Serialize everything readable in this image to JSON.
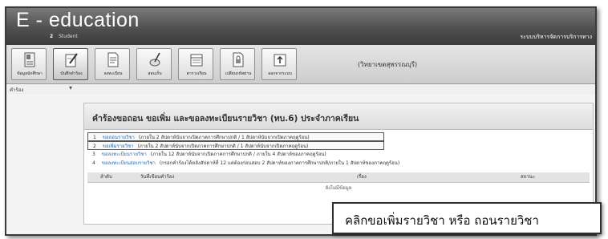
{
  "header": {
    "brand": "E - education",
    "user_id": "2",
    "user_role": "Student",
    "system_title": "ระบบบริหารจัดการบริการทาง"
  },
  "toolbar": {
    "buttons": [
      {
        "label": "ข้อมูลนักศึกษา",
        "icon": "student-info-icon"
      },
      {
        "label": "บันทึกคำร้อง",
        "icon": "edit-request-icon"
      },
      {
        "label": "ลงทะเบียน",
        "icon": "register-icon"
      },
      {
        "label": "สอบเก็บ",
        "icon": "exam-icon"
      },
      {
        "label": "ตารางเรียน",
        "icon": "schedule-icon"
      },
      {
        "label": "เปลี่ยนรหัสผ่าน",
        "icon": "password-icon"
      },
      {
        "label": "ออกจากระบบ",
        "icon": "logout-icon"
      }
    ],
    "note": "(วิทยาเขตสุพรรณบุรี)"
  },
  "menu": {
    "label": "คำร้อง",
    "arrow": "▾"
  },
  "panel": {
    "title": "คำร้องขอถอน ขอเพิ่ม และขอลงทะเบียนรายวิชา (ทบ.6) ประจำภาคเรียน",
    "requests": [
      {
        "num": "1",
        "name": "ขอถอนรายวิชา",
        "desc": "(ภายใน 2 สัปดาห์นับจากเปิดภาคการศึกษาปกติ / 1 สัปดาห์นับจากเปิดภาคฤดูร้อน)"
      },
      {
        "num": "2",
        "name": "ขอเพิ่มรายวิชา",
        "desc": "(ภายใน 2 สัปดาห์นับจากเปิดภาคการศึกษาปกติ / 1 สัปดาห์นับจากเปิดภาคฤดูร้อน)"
      },
      {
        "num": "3",
        "name": "ขอลงทะเบียนรายวิชา",
        "desc": "(ภายใน 12 สัปดาห์นับจากเปิดภาคการศึกษาปกติ / ภายใน 4 สัปดาห์ของภาคฤดูร้อน)"
      },
      {
        "num": "4",
        "name": "ขอลงทะเบียนสอบรายวิชา",
        "desc": "(กรอกคำร้องได้หลังสัปดาห์ที่ 12 แต่ต้องก่อนสอบ 2 สัปดาห์ของภาคการศึกษาปกติ/ภายใน 1 สัปดาห์ของภาคฤดูร้อน)"
      }
    ],
    "table_headers": [
      "ลำดับ",
      "วันที่เขียนคำร้อง",
      "เรื่อง",
      "สถานะ"
    ],
    "no_data": "ยังไม่มีข้อมูล"
  },
  "callout": {
    "text": "คลิกขอเพิ่มรายวิชา หรือ ถอนรายวิชา"
  },
  "colors": {
    "header_dark": "#3c3c3c",
    "header_light": "#7a7a7a",
    "link_blue": "#2b6cb0"
  }
}
